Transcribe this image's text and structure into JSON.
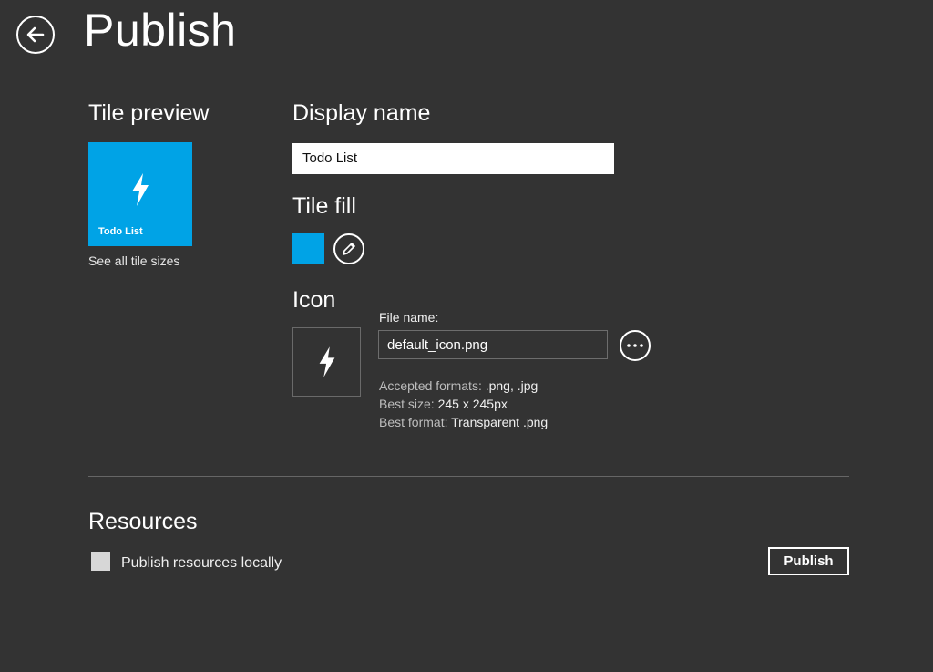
{
  "header": {
    "title": "Publish",
    "back_icon": "arrow-left-icon"
  },
  "tile_preview": {
    "heading": "Tile preview",
    "tile_label": "Todo List",
    "tile_icon": "lightning-bolt-icon",
    "tile_color": "#00a3e6",
    "see_all_link": "See all tile sizes"
  },
  "display_name": {
    "heading": "Display name",
    "value": "Todo List"
  },
  "tile_fill": {
    "heading": "Tile fill",
    "color": "#00a3e6",
    "edit_icon": "pencil-icon"
  },
  "icon": {
    "heading": "Icon",
    "preview_icon": "lightning-bolt-icon",
    "file_label": "File name:",
    "file_value": "default_icon.png",
    "browse_icon": "ellipsis-icon",
    "accepted_label": "Accepted formats:",
    "accepted_value": ".png, .jpg",
    "size_label": "Best size:",
    "size_value": "245 x 245px",
    "format_label": "Best format:",
    "format_value": "Transparent .png"
  },
  "resources": {
    "heading": "Resources",
    "checkbox_label": "Publish resources locally",
    "publish_button": "Publish"
  }
}
